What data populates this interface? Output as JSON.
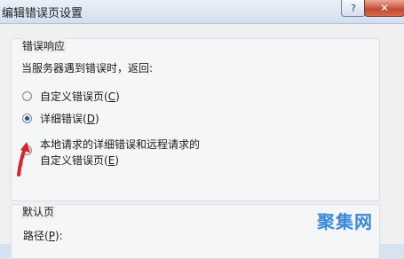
{
  "window": {
    "title": "编辑错误页设置",
    "help_label": "?",
    "close_label": "✕"
  },
  "error_group": {
    "legend": "错误响应",
    "prompt": "当服务器遇到错误时，返回:",
    "options": [
      {
        "pre": "自定义错误页(",
        "key": "C",
        "post": ")"
      },
      {
        "pre": "详细错误(",
        "key": "D",
        "post": ")"
      },
      {
        "line1": "本地请求的详细错误和远程请求的",
        "pre": "自定义错误页(",
        "key": "E",
        "post": ")"
      }
    ],
    "selected": 1
  },
  "default_group": {
    "legend": "默认页",
    "path_label_pre": "路径(",
    "path_key": "P",
    "path_label_post": "):"
  },
  "watermark": "聚集网",
  "colors": {
    "arrow": "#d8232a",
    "watermark": "#3c8ad8",
    "radio_dot": "#1c4fa8"
  }
}
